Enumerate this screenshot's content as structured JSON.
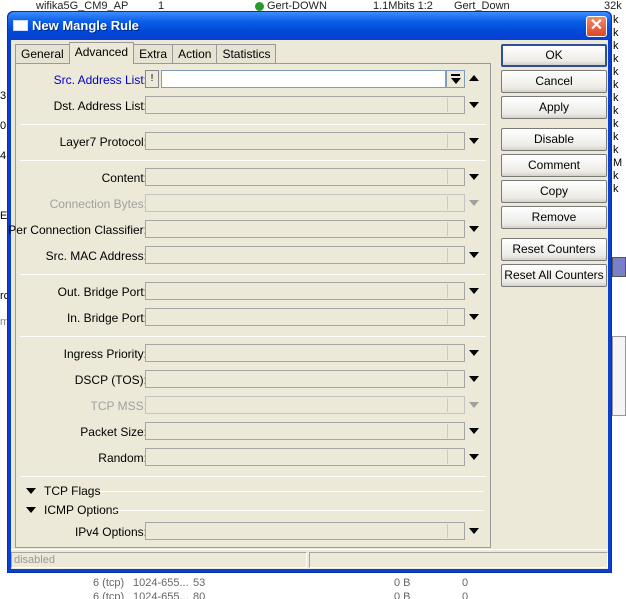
{
  "background": {
    "top_row": {
      "name": "wifika5G_CM9_AP",
      "num": "1",
      "target": "Gert-DOWN",
      "rate": "1.1Mbits 1:2",
      "parent": "Gert_Down",
      "right": "32k"
    },
    "bottom_rows": [
      {
        "protocol": "6 (tcp)",
        "ports": "1024-655...",
        "port": "53",
        "bytes": "0 B",
        "packets": "0"
      },
      {
        "protocol": "6 (tcp)",
        "ports": "1024-655...",
        "port": "80",
        "bytes": "0 B",
        "packets": "0"
      }
    ],
    "left_fragments": [
      "3",
      "0",
      "4",
      "E",
      "rc",
      "m"
    ],
    "right_fragments": [
      "k",
      "k",
      "k",
      "k",
      "k",
      "k",
      "k",
      "k",
      "k",
      "k",
      "k",
      "M",
      "k",
      "k"
    ]
  },
  "window": {
    "title": "New Mangle Rule",
    "close_label": "✕"
  },
  "tabs": [
    "General",
    "Advanced",
    "Extra",
    "Action",
    "Statistics"
  ],
  "active_tab": "Advanced",
  "fields": {
    "src_address_list": {
      "label": "Src. Address List:",
      "not_label": "!",
      "value": ""
    },
    "dst_address_list": {
      "label": "Dst. Address List:"
    },
    "layer7_protocol": {
      "label": "Layer7 Protocol:"
    },
    "content": {
      "label": "Content:"
    },
    "connection_bytes": {
      "label": "Connection Bytes:"
    },
    "per_connection_classifier": {
      "label": "Per Connection Classifier:"
    },
    "src_mac_address": {
      "label": "Src. MAC Address:"
    },
    "out_bridge_port": {
      "label": "Out. Bridge Port:"
    },
    "in_bridge_port": {
      "label": "In. Bridge Port:"
    },
    "ingress_priority": {
      "label": "Ingress Priority:"
    },
    "dscp_tos": {
      "label": "DSCP (TOS):"
    },
    "tcp_mss": {
      "label": "TCP MSS:"
    },
    "packet_size": {
      "label": "Packet Size:"
    },
    "random": {
      "label": "Random:"
    },
    "ipv4_options": {
      "label": "IPv4 Options:"
    }
  },
  "sections": {
    "tcp_flags": "TCP Flags",
    "icmp_options": "ICMP Options"
  },
  "buttons": {
    "ok": "OK",
    "cancel": "Cancel",
    "apply": "Apply",
    "disable": "Disable",
    "comment": "Comment",
    "copy": "Copy",
    "remove": "Remove",
    "reset_counters": "Reset Counters",
    "reset_all_counters": "Reset All Counters"
  },
  "status": {
    "text": "disabled"
  }
}
